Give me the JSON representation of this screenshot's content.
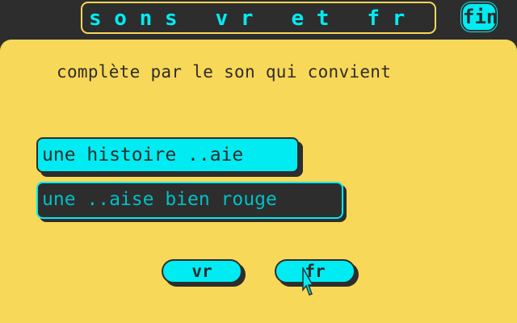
{
  "header": {
    "title": "s o n s   v r   e t   f r",
    "exit_label": "fin"
  },
  "exercise": {
    "instruction": "complète par le son qui convient",
    "sentences": [
      {
        "text": "une histoire ..aie",
        "state": "active"
      },
      {
        "text": "une ..aise bien rouge",
        "state": "inactive"
      }
    ]
  },
  "choices": [
    {
      "label": "vr"
    },
    {
      "label": "fr"
    }
  ],
  "colors": {
    "background": "#2d2d2d",
    "panel": "#f8d858",
    "accent": "#00ecf2"
  },
  "pointer": {
    "icon": "arrow-pointer-icon"
  }
}
